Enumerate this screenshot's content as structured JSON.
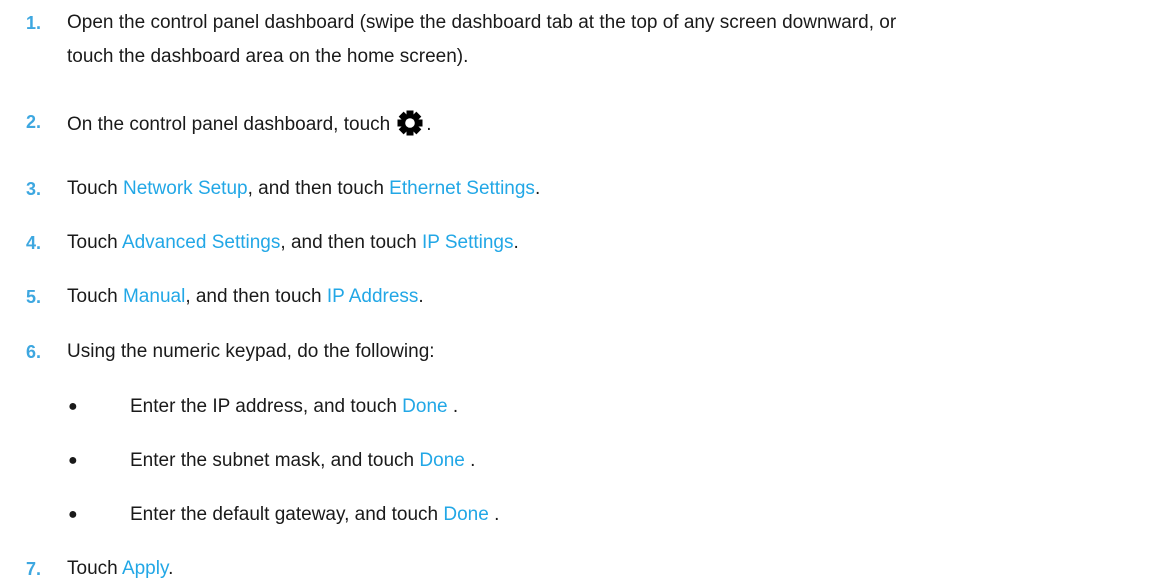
{
  "steps": [
    {
      "num": "1.",
      "text": "Open the control panel dashboard (swipe the dashboard tab at the top of any screen downward, or",
      "text2": "touch the dashboard area on the home screen)."
    },
    {
      "num": "2.",
      "text": "On the control panel dashboard, touch",
      "after": ".",
      "icon": "gear-icon"
    },
    {
      "num": "3.",
      "pre": "Touch ",
      "l1": "Network Setup",
      "mid": ", and then touch ",
      "l2": "Ethernet Settings",
      "post": "."
    },
    {
      "num": "4.",
      "pre": "Touch ",
      "l1": "Advanced Settings",
      "mid": ", and then touch ",
      "l2": "IP Settings",
      "post": "."
    },
    {
      "num": "5.",
      "pre": "Touch ",
      "l1": "Manual",
      "mid": ", and then touch ",
      "l2": "IP Address",
      "post": "."
    },
    {
      "num": "6.",
      "text": "Using the numeric keypad, do the following:"
    },
    {
      "num": "7.",
      "pre": "Touch ",
      "l1": "Apply",
      "post": "."
    }
  ],
  "bullets": [
    {
      "symbol": "●",
      "pre": "Enter the IP address, and touch ",
      "link": "Done",
      "post": " ."
    },
    {
      "symbol": "●",
      "pre": "Enter the subnet mask, and touch ",
      "link": "Done",
      "post": " ."
    },
    {
      "symbol": "●",
      "pre": "Enter the default gateway, and touch ",
      "link": "Done",
      "post": " ."
    }
  ],
  "colors": {
    "link": "#22a7e6",
    "number": "#3da7e0",
    "text": "#1a1a1a"
  }
}
